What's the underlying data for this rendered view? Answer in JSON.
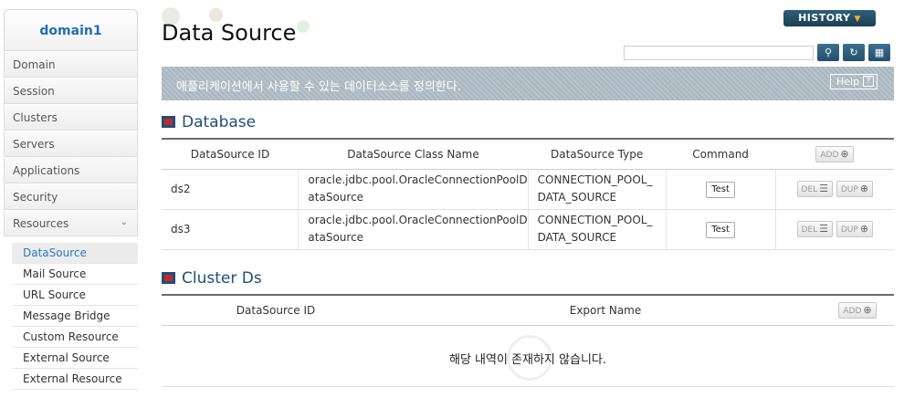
{
  "sidebar": {
    "domain": "domain1",
    "items": [
      {
        "label": "Domain"
      },
      {
        "label": "Session"
      },
      {
        "label": "Clusters"
      },
      {
        "label": "Servers"
      },
      {
        "label": "Applications"
      },
      {
        "label": "Security"
      },
      {
        "label": "Resources"
      }
    ],
    "sub_items": [
      {
        "label": "DataSource",
        "active": true
      },
      {
        "label": "Mail Source"
      },
      {
        "label": "URL Source"
      },
      {
        "label": "Message Bridge"
      },
      {
        "label": "Custom Resource"
      },
      {
        "label": "External Source"
      },
      {
        "label": "External Resource"
      }
    ]
  },
  "header": {
    "title": "Data Source",
    "history_label": "HISTORY",
    "search_placeholder": ""
  },
  "banner": {
    "text": "애플리케이션에서 사용할 수 있는 데이터소스를 정의한다.",
    "help_label": "Help"
  },
  "database": {
    "section_title": "Database",
    "columns": [
      "DataSource ID",
      "DataSource Class Name",
      "DataSource Type",
      "Command"
    ],
    "add_label": "ADD",
    "rows": [
      {
        "id": "ds2",
        "class_line1": "oracle.jdbc.pool.OracleConnectionPoolD",
        "class_line2": "ataSource",
        "type_line1": "CONNECTION_POOL_",
        "type_line2": "DATA_SOURCE",
        "command": "Test",
        "del_label": "DEL",
        "dup_label": "DUP"
      },
      {
        "id": "ds3",
        "class_line1": "oracle.jdbc.pool.OracleConnectionPoolD",
        "class_line2": "ataSource",
        "type_line1": "CONNECTION_POOL_",
        "type_line2": "DATA_SOURCE",
        "command": "Test",
        "del_label": "DEL",
        "dup_label": "DUP"
      }
    ]
  },
  "cluster_ds": {
    "section_title": "Cluster Ds",
    "columns": [
      "DataSource ID",
      "Export Name"
    ],
    "add_label": "ADD",
    "empty_text": "해당 내역이 존재하지 않습니다."
  }
}
